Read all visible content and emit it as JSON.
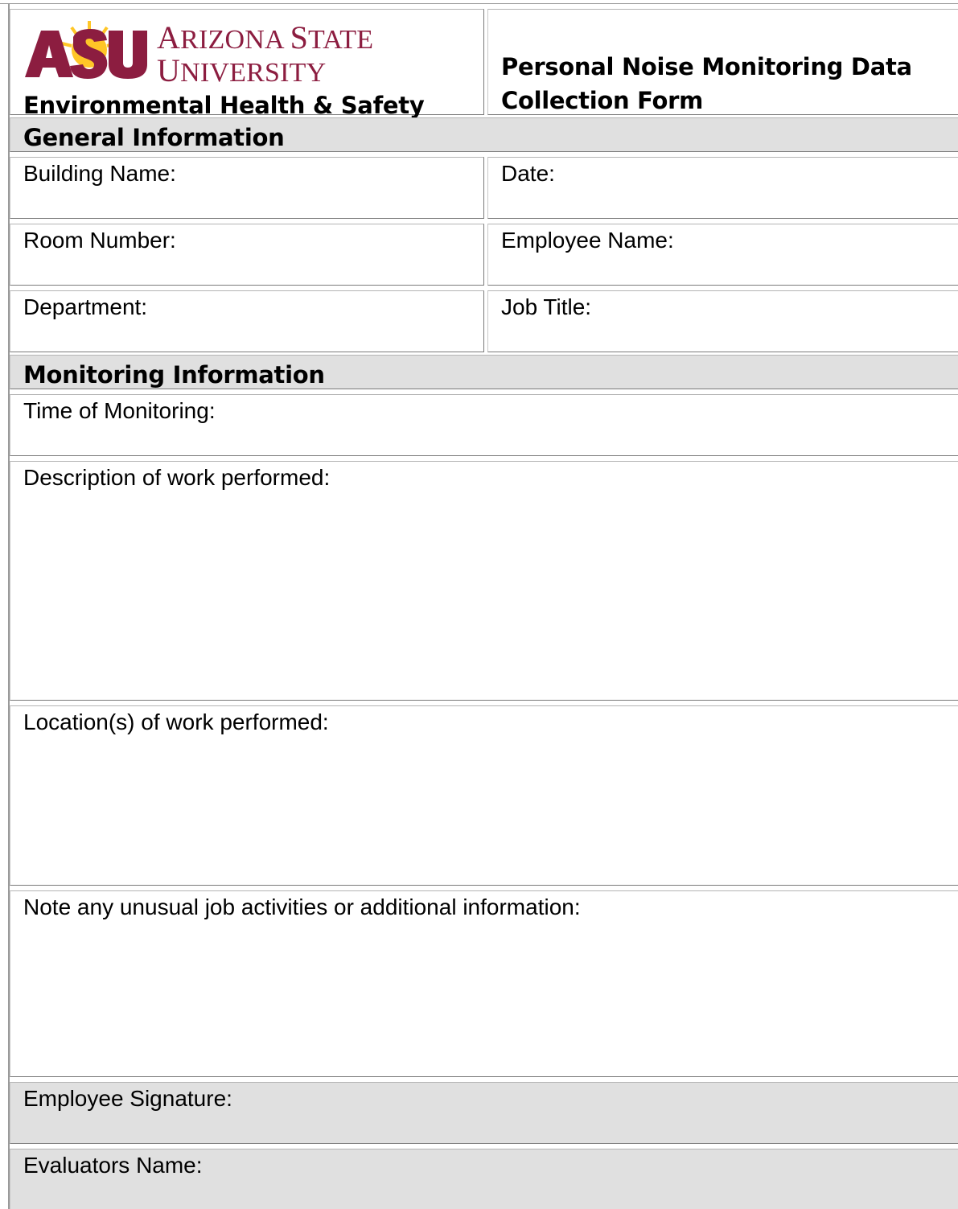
{
  "header": {
    "logo": {
      "mark": "ASU",
      "wordmark_line1_first": "A",
      "wordmark_line1_rest": "RIZONA",
      "wordmark_line1_second": "S",
      "wordmark_line1_second_rest": "TATE",
      "wordmark_line2_first": "U",
      "wordmark_line2_rest": "NIVERSITY",
      "colors": {
        "maroon": "#8C1D40",
        "gold": "#FFC627"
      }
    },
    "department": "Environmental Health & Safety",
    "form_title_line1": "Personal Noise Monitoring Data",
    "form_title_line2": "Collection Form"
  },
  "sections": {
    "general": {
      "title": "General Information",
      "building_name": "Building Name:",
      "date": "Date:",
      "room_number": "Room Number:",
      "employee_name": "Employee Name:",
      "department": "Department:",
      "job_title": "Job Title:"
    },
    "monitoring": {
      "title": "Monitoring Information",
      "time_of_monitoring": "Time of Monitoring:",
      "description": "Description of work performed:",
      "locations": "Location(s) of work performed:",
      "notes": "Note any unusual job activities or additional information:",
      "employee_signature": "Employee Signature:",
      "evaluators_name": "Evaluators Name:"
    }
  }
}
